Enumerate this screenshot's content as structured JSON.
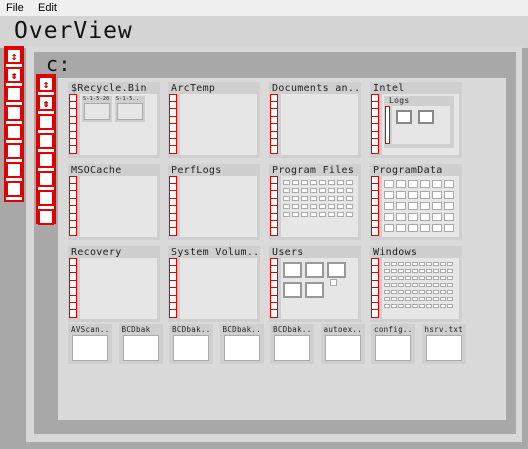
{
  "menu": {
    "file": "File",
    "edit": "Edit"
  },
  "title": "OverView",
  "drive_label": "c:",
  "folders": {
    "recycle": {
      "name": "$Recycle.Bin",
      "children": [
        "S-1-5-20",
        "S-1-5.."
      ]
    },
    "arctemp": {
      "name": "ArcTemp"
    },
    "documents": {
      "name": "Documents an.."
    },
    "intel": {
      "name": "Intel",
      "children": [
        "Logs"
      ]
    },
    "msocache": {
      "name": "MSOCache"
    },
    "perflogs": {
      "name": "PerfLogs"
    },
    "programfiles": {
      "name": "Program Files"
    },
    "programdata": {
      "name": "ProgramData"
    },
    "recovery": {
      "name": "Recovery"
    },
    "systemvolume": {
      "name": "System Volum.."
    },
    "users": {
      "name": "Users"
    },
    "windows": {
      "name": "Windows"
    }
  },
  "files": [
    "AVScan..",
    "BCDbak",
    "BCDbak..",
    "BCDbak..",
    "BCDbak..",
    "autoex..",
    "config..",
    "hsrv.txt"
  ],
  "colors": {
    "accent_red": "#e00000",
    "background": "#a8a8a8"
  }
}
